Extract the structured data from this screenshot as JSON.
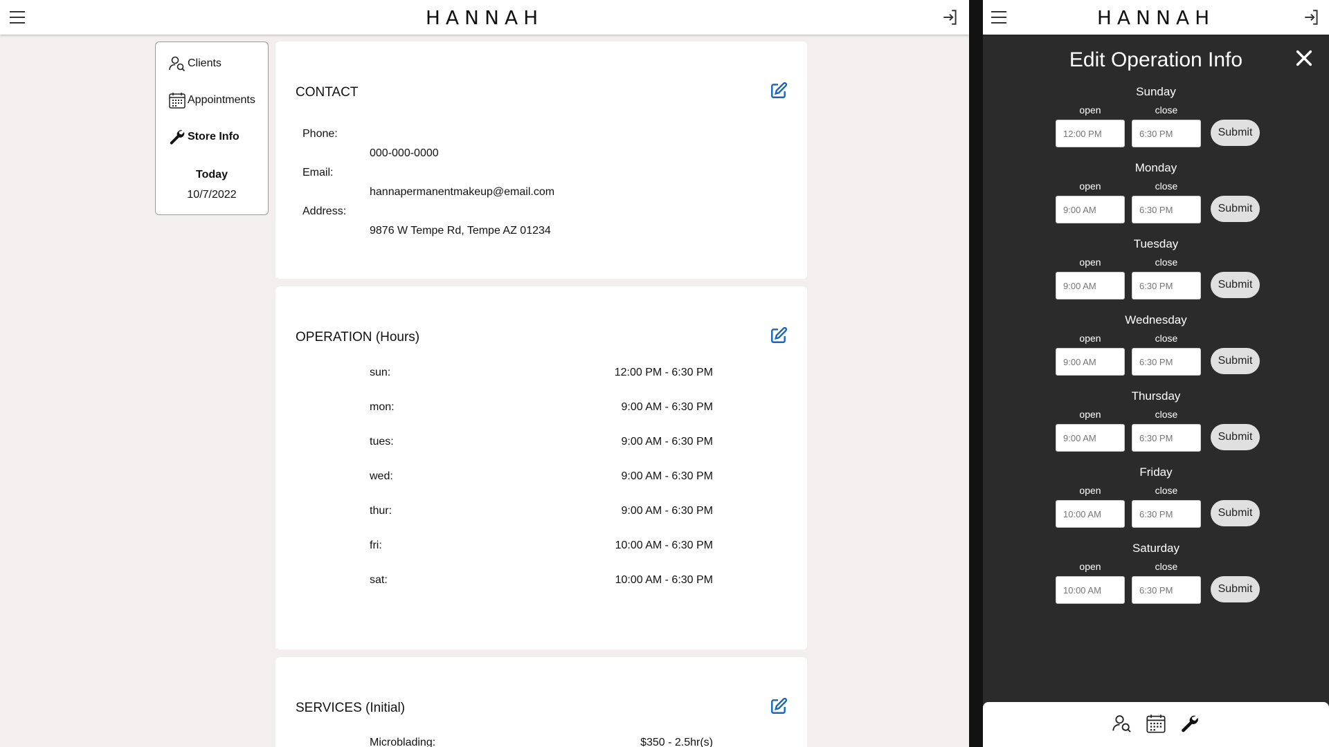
{
  "header": {
    "brand": "HANNAH"
  },
  "nav": {
    "items": [
      {
        "label": "Clients",
        "icon": "client-search-icon"
      },
      {
        "label": "Appointments",
        "icon": "calendar-icon"
      },
      {
        "label": "Store Info",
        "icon": "wrench-icon"
      }
    ],
    "today_label": "Today",
    "today_date": "10/7/2022"
  },
  "contact": {
    "title": "CONTACT",
    "phone_label": "Phone:",
    "phone": "000-000-0000",
    "email_label": "Email:",
    "email": "hannapermanentmakeup@email.com",
    "address_label": "Address:",
    "address": "9876 W Tempe Rd, Tempe AZ 01234"
  },
  "operation": {
    "title": "OPERATION (Hours)",
    "rows": [
      {
        "day": "sun:",
        "hours": "12:00 PM - 6:30 PM"
      },
      {
        "day": "mon:",
        "hours": "9:00 AM - 6:30 PM"
      },
      {
        "day": "tues:",
        "hours": "9:00 AM - 6:30 PM"
      },
      {
        "day": "wed:",
        "hours": "9:00 AM - 6:30 PM"
      },
      {
        "day": "thur:",
        "hours": "9:00 AM - 6:30 PM"
      },
      {
        "day": "fri:",
        "hours": "10:00 AM - 6:30 PM"
      },
      {
        "day": "sat:",
        "hours": "10:00 AM - 6:30 PM"
      }
    ]
  },
  "services": {
    "title": "SERVICES (Initial)",
    "first_row": {
      "name": "Microblading:",
      "value": "$350 - 2.5hr(s)"
    }
  },
  "edit_modal": {
    "title": "Edit Operation Info",
    "open_label": "open",
    "close_label": "close",
    "submit_label": "Submit",
    "days": [
      {
        "name": "Sunday",
        "open_placeholder": "12:00 PM",
        "close_placeholder": "6:30 PM"
      },
      {
        "name": "Monday",
        "open_placeholder": "9:00 AM",
        "close_placeholder": "6:30 PM"
      },
      {
        "name": "Tuesday",
        "open_placeholder": "9:00 AM",
        "close_placeholder": "6:30 PM"
      },
      {
        "name": "Wednesday",
        "open_placeholder": "9:00 AM",
        "close_placeholder": "6:30 PM"
      },
      {
        "name": "Thursday",
        "open_placeholder": "9:00 AM",
        "close_placeholder": "6:30 PM"
      },
      {
        "name": "Friday",
        "open_placeholder": "10:00 AM",
        "close_placeholder": "6:30 PM"
      },
      {
        "name": "Saturday",
        "open_placeholder": "10:00 AM",
        "close_placeholder": "6:30 PM"
      }
    ]
  },
  "colors": {
    "accent": "#1565c0",
    "page_bg": "#f3efee",
    "modal_bg": "#2b2b2b"
  }
}
